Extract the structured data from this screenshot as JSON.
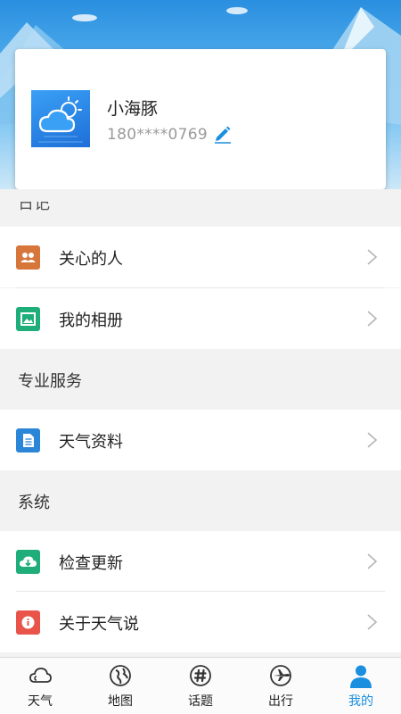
{
  "profile": {
    "name": "小海豚",
    "phone": "180****0769",
    "avatar_icon": "weather-app-icon",
    "edit_icon": "pencil-icon"
  },
  "sections": {
    "partial_label": "日记",
    "professional": "专业服务",
    "system": "系统"
  },
  "rows": {
    "care": {
      "label": "关心的人",
      "icon": "people-icon",
      "color": "#d6763a"
    },
    "album": {
      "label": "我的相册",
      "icon": "photo-icon",
      "color": "#1fae79"
    },
    "weather_data": {
      "label": "天气资料",
      "icon": "document-icon",
      "color": "#2c86d8"
    },
    "check_update": {
      "label": "检查更新",
      "icon": "cloud-download-icon",
      "color": "#1fae79"
    },
    "about": {
      "label": "关于天气说",
      "icon": "info-icon",
      "color": "#e8544a"
    }
  },
  "tabs": [
    {
      "label": "天气",
      "icon": "cloud-icon"
    },
    {
      "label": "地图",
      "icon": "globe-icon"
    },
    {
      "label": "话题",
      "icon": "hashtag-icon"
    },
    {
      "label": "出行",
      "icon": "airplane-icon"
    },
    {
      "label": "我的",
      "icon": "user-icon",
      "active": true
    }
  ],
  "colors": {
    "accent": "#1a8fe0",
    "chevron": "#b5b5b5"
  }
}
